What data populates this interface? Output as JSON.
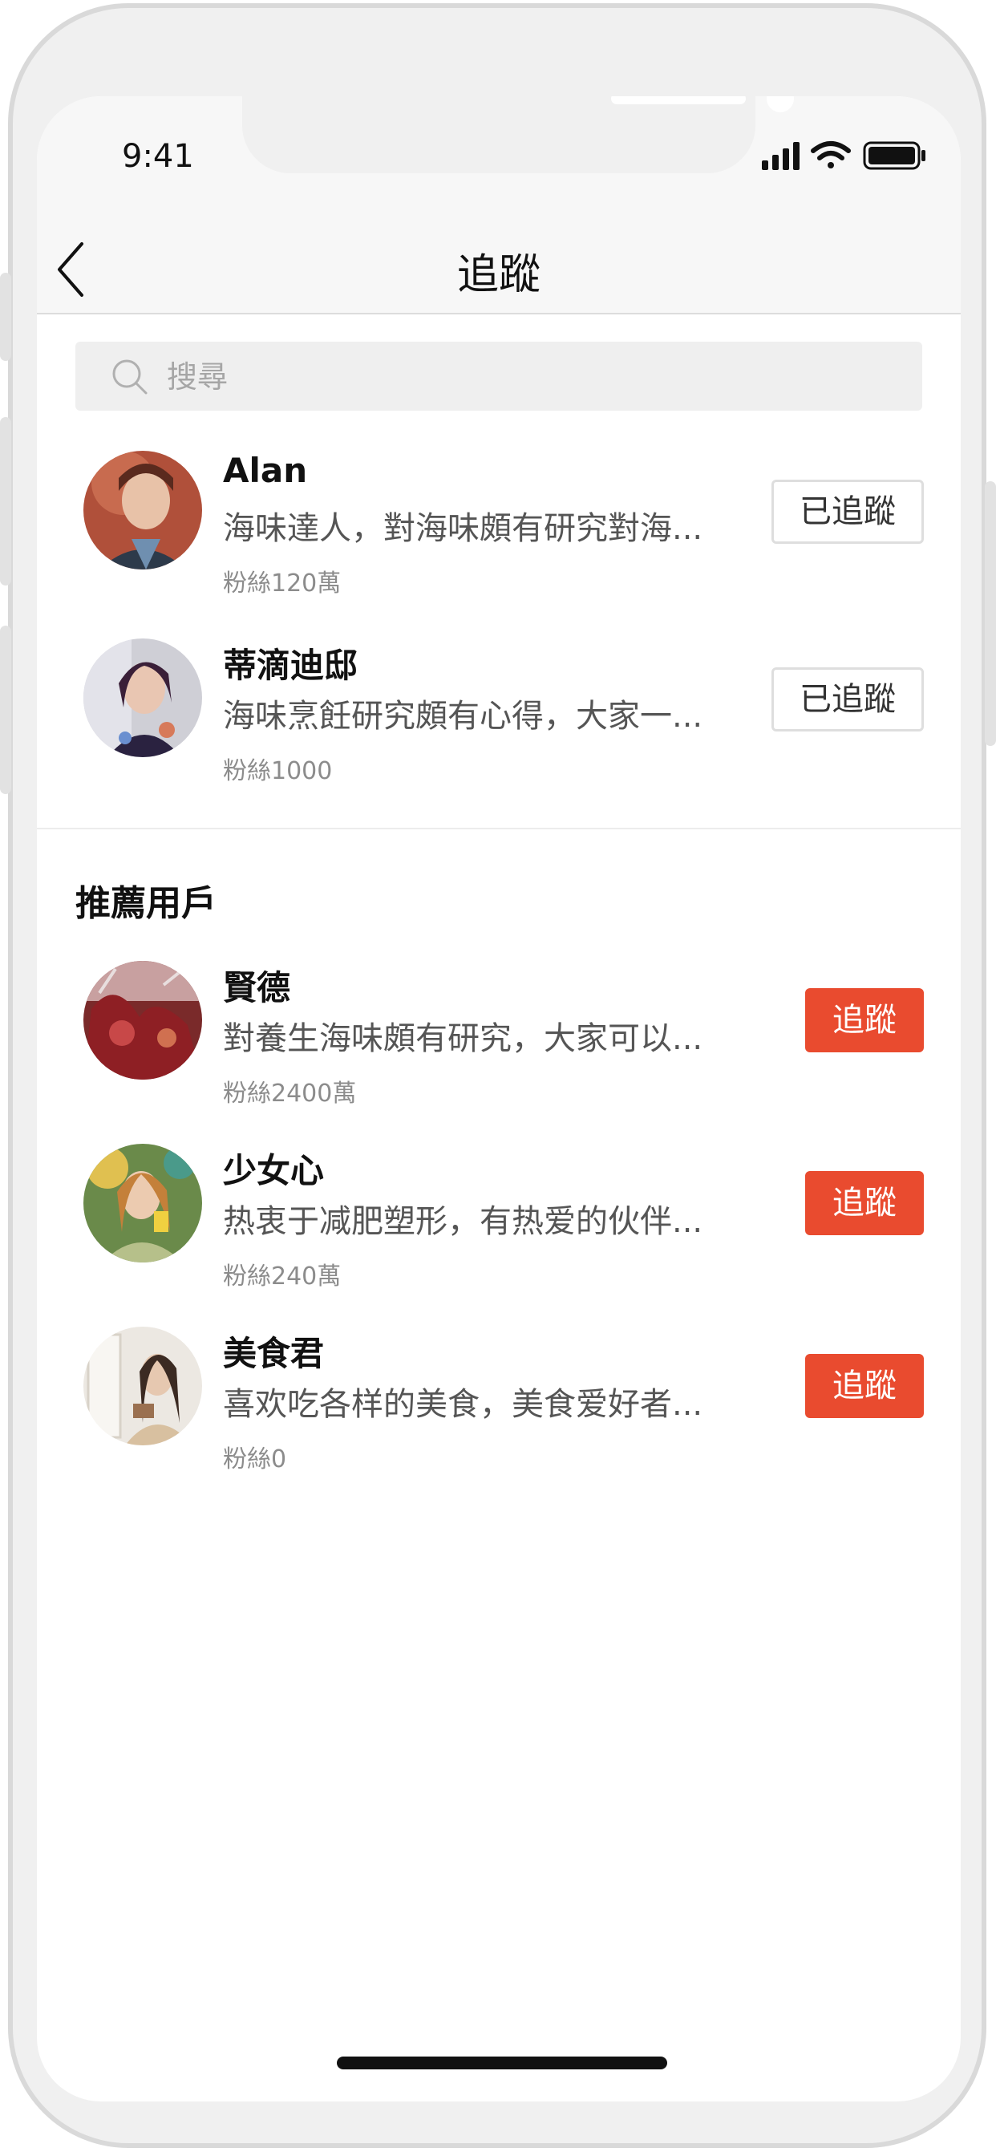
{
  "status_bar": {
    "time": "9:41",
    "icons": [
      "signal-icon",
      "wifi-icon",
      "battery-icon"
    ]
  },
  "nav": {
    "title": "追蹤",
    "back_icon": "chevron-left-icon"
  },
  "search": {
    "placeholder": "搜尋",
    "icon": "search-icon"
  },
  "following": [
    {
      "name": "Alan",
      "bio": "海味達人，對海味頗有研究對海...",
      "fans": "粉絲120萬",
      "button": "已追蹤"
    },
    {
      "name": "蒂滴迪邸",
      "bio": "海味烹飪研究頗有心得，大家一...",
      "fans": "粉絲1000",
      "button": "已追蹤"
    }
  ],
  "recommended": {
    "title": "推薦用戶",
    "users": [
      {
        "name": "賢德",
        "bio": "對養生海味頗有研究，大家可以...",
        "fans": "粉絲2400萬",
        "button": "追蹤"
      },
      {
        "name": "少女心",
        "bio": "热衷于减肥塑形，有热爱的伙伴...",
        "fans": "粉絲240萬",
        "button": "追蹤"
      },
      {
        "name": "美食君",
        "bio": "喜欢吃各样的美食，美食爱好者...",
        "fans": "粉絲0",
        "button": "追蹤"
      }
    ]
  },
  "colors": {
    "accent": "#e94b2f",
    "background": "#ffffff",
    "navbar": "#f7f7f7"
  }
}
